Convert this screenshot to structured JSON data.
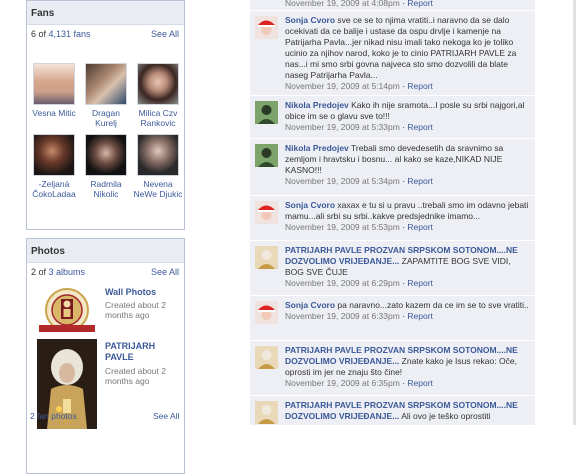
{
  "fans_box": {
    "title": "Fans",
    "count_prefix": "6 of ",
    "count_link": "4,131 fans",
    "see_all": "See All",
    "items": [
      {
        "name_line1": "Vesna Mitic",
        "name_line2": ""
      },
      {
        "name_line1": "Dragan",
        "name_line2": "Kurelj"
      },
      {
        "name_line1": "Milica Czv",
        "name_line2": "Rankovic"
      },
      {
        "name_line1": "-Zeljaná",
        "name_line2": "ČokoLadaa"
      },
      {
        "name_line1": "Radmila",
        "name_line2": "Nikolic"
      },
      {
        "name_line1": "Nevena",
        "name_line2": "NeWe Djukic"
      }
    ]
  },
  "photos_box": {
    "title": "Photos",
    "count_prefix": "2 of ",
    "count_link": "3 albums",
    "see_all": "See All",
    "albums": [
      {
        "title": "Wall Photos",
        "created": "Created about 2 months ago"
      },
      {
        "title": "PATRIJARH PAVLE",
        "created": "Created about 2 months ago"
      }
    ],
    "fan_photos": "2 fan photos",
    "see_all_bottom": "See All"
  },
  "wall": {
    "report_label": "Report",
    "posts": [
      {
        "author": "Sonja Cvoro",
        "text": " sve ce se to njima vratiti..i naravno da se dalo ocekivati da ce balije i ustase da ospu drvlje i kamenje na Patrijarha Pavla...jer nikad nisu imali tako nekoga ko je toliko ucinio za njihov narod, koko je to cinio PATRIJARH PAVLE za nas...i mi smo srbi govna najveca sto smo dozvolili da blate naseg Patrijarha Pavla...",
        "time": "November 19, 2009 at 5:14pm"
      },
      {
        "author": "Nikola Predojev",
        "text": " Kako ih nije sramota...I posle su srbi najgori,al obice im se o glavu sve to!!!",
        "time": "November 19, 2009 at 5:33pm"
      },
      {
        "author": "Nikola Predojev",
        "text": " Trebali smo devedesetih da sravnimo sa zemljom i hravtsku i bosnu... al kako se kaze,NIKAD NIJE KASNO!!!",
        "time": "November 19, 2009 at 5:34pm"
      },
      {
        "author": "Sonja Cvoro",
        "text": " xaxax e tu si u pravu ..trebali smo im odavno jebati mamu...ali srbi su srbi..kakve predsjednike imamo...",
        "time": "November 19, 2009 at 5:53pm"
      },
      {
        "author": "PATRIJARH PAVLE PROZVAN SRPSKOM SOTONOM....NE DOZVOLIMO VRIJEĐANJE...",
        "text": " ZAPAMTITE BOG SVE VIDI, BOG SVE ČUJE",
        "time": "November 19, 2009 at 6:29pm"
      },
      {
        "author": "Sonja Cvoro",
        "text": " pa naravno...zato kazem da ce im se to sve vratiti..",
        "time": "November 19, 2009 at 6:33pm"
      },
      {
        "author": "PATRIJARH PAVLE PROZVAN SRPSKOM SOTONOM....NE DOZVOLIMO VRIJEĐANJE...",
        "text": " Znate kako je Isus rekao: Oče, oprosti im jer ne znaju što čine!",
        "time": "November 19, 2009 at 6:35pm"
      },
      {
        "author": "PATRIJARH PAVLE PROZVAN SRPSKOM SOTONOM....NE DOZVOLIMO VRIJEĐANJE...",
        "text": " Ali ovo je teško oprostiti",
        "time": ""
      }
    ],
    "top_partial_time": "November 19, 2009 at 4:08pm"
  }
}
